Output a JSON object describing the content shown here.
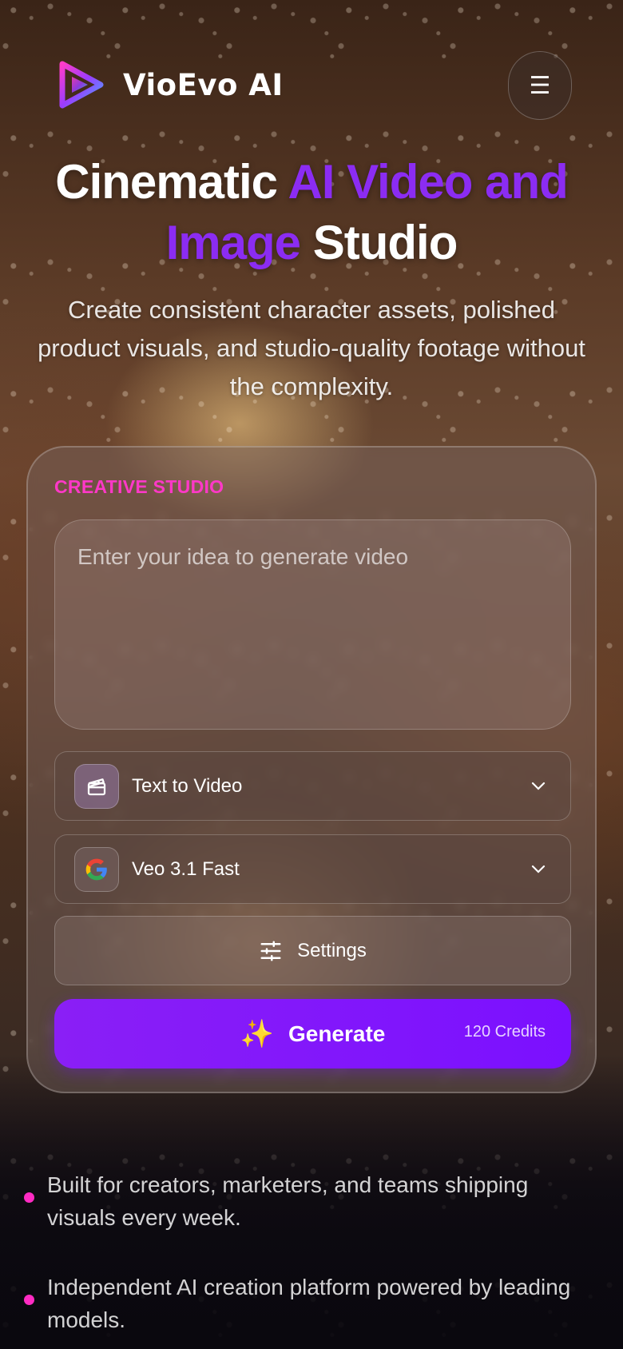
{
  "app": {
    "name": "VioEvo AI",
    "logo_icon": "play-logo-icon",
    "menu_icon": "hamburger-menu-icon",
    "menu_glyph": "☰"
  },
  "hero": {
    "title_part1": "Cinematic ",
    "title_accent": "AI Video and Image",
    "title_part2": " Studio",
    "subtitle": "Create consistent character assets, polished product visuals, and studio-quality footage without the complexity."
  },
  "studio": {
    "label": "CREATIVE STUDIO",
    "prompt_placeholder": "Enter your idea to generate video",
    "mode": {
      "icon": "clapperboard-icon",
      "value": "Text to Video"
    },
    "model": {
      "icon": "google-icon",
      "value": "Veo 3.1 Fast"
    },
    "settings": {
      "icon": "sliders-icon",
      "label": "Settings"
    },
    "generate": {
      "icon": "sparkles-icon",
      "glyph": "✨",
      "label": "Generate",
      "credits": "120 Credits"
    }
  },
  "bullets": [
    "Built for creators, marketers, and teams shipping visuals every week.",
    "Independent AI creation platform powered by leading models."
  ],
  "colors": {
    "accent_purple": "#8b2cf2",
    "label_pink": "#ff38c8",
    "generate_start": "#8a1ff6",
    "generate_end": "#7b10ff",
    "bullet_dot": "#ff2bc3"
  }
}
